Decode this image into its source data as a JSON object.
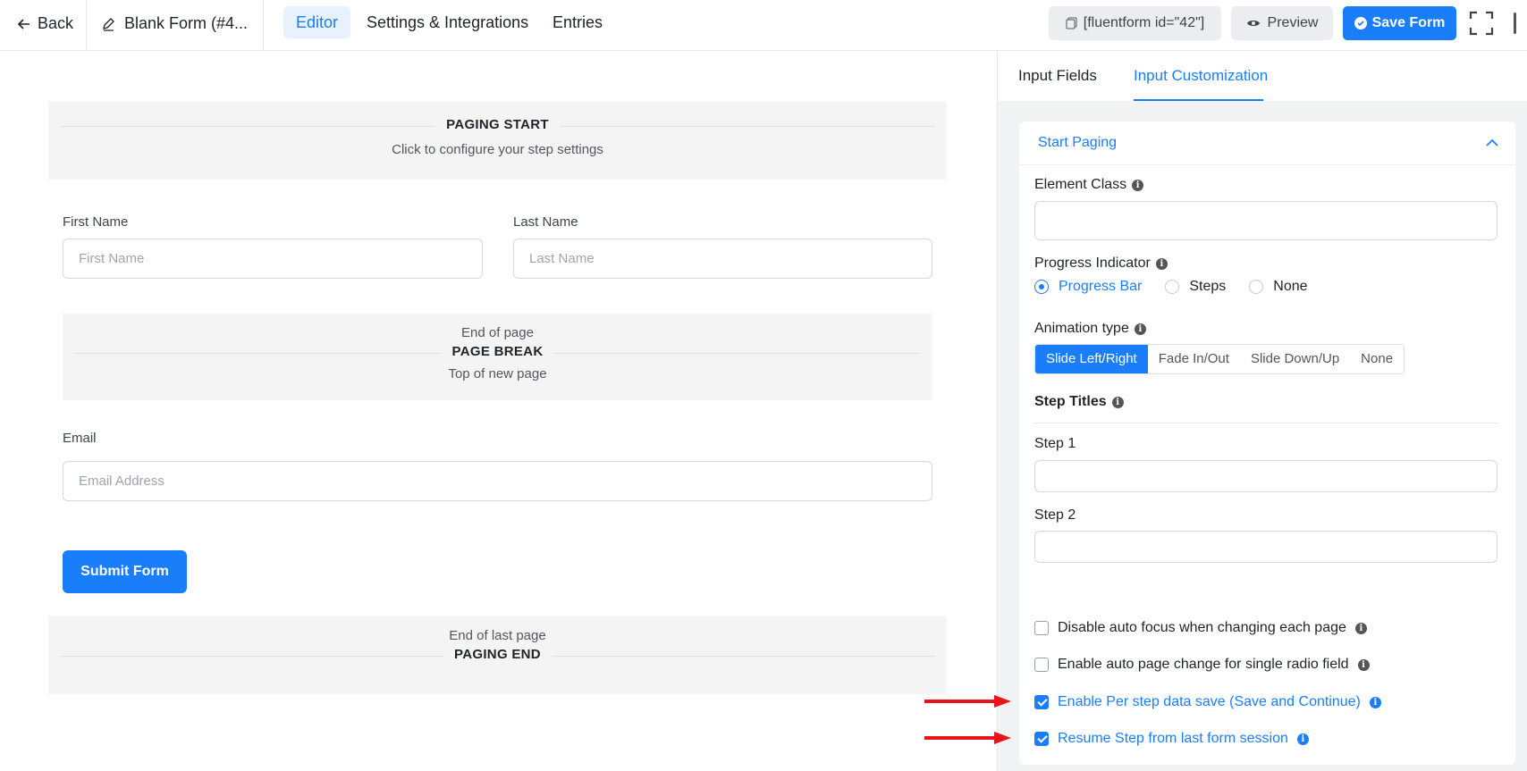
{
  "topbar": {
    "back_label": "Back",
    "form_title": "Blank Form (#4...",
    "tabs": [
      {
        "label": "Editor",
        "active": true
      },
      {
        "label": "Settings & Integrations",
        "active": false
      },
      {
        "label": "Entries",
        "active": false
      }
    ],
    "shortcode": "[fluentform id=\"42\"]",
    "preview_label": "Preview",
    "save_label": "Save Form"
  },
  "canvas": {
    "paging_start": {
      "title": "PAGING START",
      "subtitle": "Click to configure your step settings"
    },
    "fields": {
      "first_name": {
        "label": "First Name",
        "placeholder": "First Name"
      },
      "last_name": {
        "label": "Last Name",
        "placeholder": "Last Name"
      },
      "email": {
        "label": "Email",
        "placeholder": "Email Address"
      }
    },
    "page_break": {
      "top": "End of page",
      "title": "PAGE BREAK",
      "bottom": "Top of new page"
    },
    "submit_label": "Submit Form",
    "paging_end": {
      "top": "End of last page",
      "title": "PAGING END"
    }
  },
  "panel": {
    "tabs": [
      {
        "label": "Input Fields",
        "active": false
      },
      {
        "label": "Input Customization",
        "active": true
      }
    ],
    "section_title": "Start Paging",
    "element_class_label": "Element Class",
    "progress_indicator": {
      "label": "Progress Indicator",
      "options": [
        "Progress Bar",
        "Steps",
        "None"
      ],
      "selected": "Progress Bar"
    },
    "animation": {
      "label": "Animation type",
      "options": [
        "Slide Left/Right",
        "Fade In/Out",
        "Slide Down/Up",
        "None"
      ],
      "selected": "Slide Left/Right"
    },
    "step_titles_label": "Step Titles",
    "steps": [
      "Step 1",
      "Step 2"
    ],
    "checkboxes": [
      {
        "label": "Disable auto focus when changing each page",
        "checked": false
      },
      {
        "label": "Enable auto page change for single radio field",
        "checked": false
      },
      {
        "label": "Enable Per step data save (Save and Continue)",
        "checked": true
      },
      {
        "label": "Resume Step from last form session",
        "checked": true
      }
    ]
  },
  "colors": {
    "accent": "#1a7efb",
    "annotation_arrow": "#e8141a"
  }
}
